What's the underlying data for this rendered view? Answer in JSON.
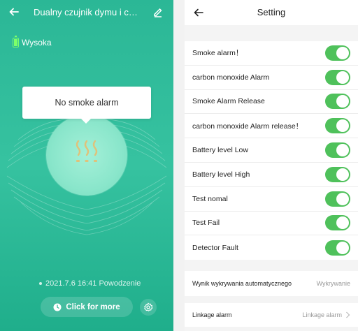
{
  "left": {
    "title": "Dualny czujnik dymu i cza...",
    "battery_label": "Wysoka",
    "bubble_text": "No smoke alarm",
    "status_text": "2021.7.6 16:41 Powodzenie",
    "more_button_label": "Click for more",
    "icons": {
      "back": "arrow-left-icon",
      "edit": "pencil-icon",
      "battery": "battery-icon",
      "smoke": "smoke-icon",
      "clock": "clock-icon",
      "settings": "gear-icon"
    }
  },
  "right": {
    "title": "Setting",
    "toggles": [
      {
        "label": "Smoke alarm！",
        "on": true
      },
      {
        "label": "carbon monoxide Alarm",
        "on": true
      },
      {
        "label": "Smoke Alarm Release",
        "on": true
      },
      {
        "label": "carbon monoxide Alarm release！",
        "on": true
      },
      {
        "label": "Battery level Low",
        "on": true
      },
      {
        "label": "Battery level High",
        "on": true
      },
      {
        "label": "Test nomal",
        "on": true
      },
      {
        "label": "Test Fail",
        "on": true
      },
      {
        "label": "Detector Fault",
        "on": true
      }
    ],
    "detection": {
      "label": "Wynik wykrywania automatycznego",
      "value": "Wykrywanie"
    },
    "linkage": {
      "label": "Linkage alarm",
      "value": "Linkage alarm"
    }
  },
  "colors": {
    "teal": "#2bb796",
    "switch_on": "#4fc15b",
    "smoke_icon": "#e0c27a"
  }
}
